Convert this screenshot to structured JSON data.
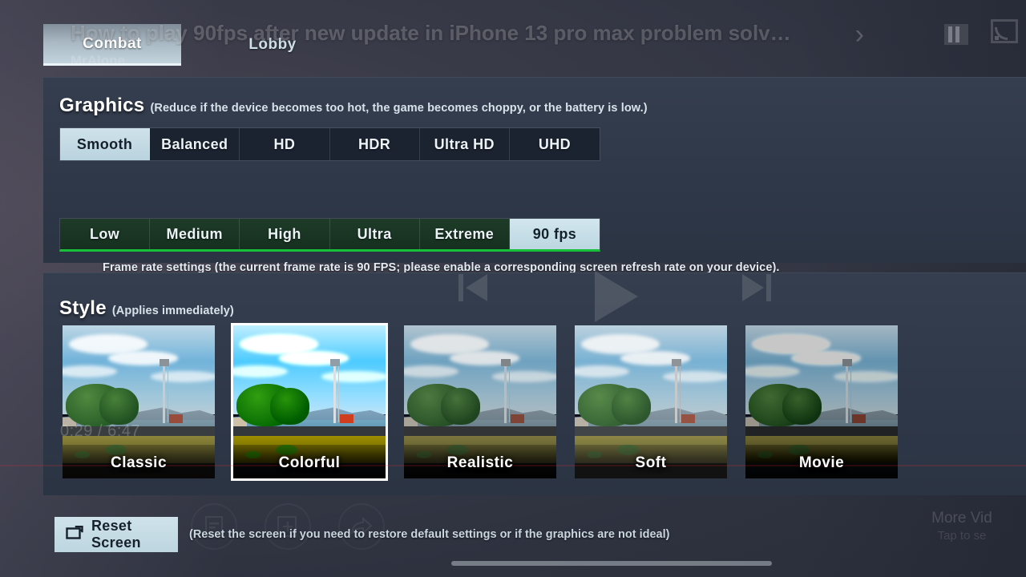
{
  "player": {
    "video_title": "How to play 90fps after new update in iPhone 13 pro max problem solv…",
    "channel": "MrAlone",
    "current_time": "0:29",
    "duration": "6:47",
    "time_display": "0:29 / 6:47",
    "chevron_icon": "chevron-right-icon",
    "pause_icon": "pause-icon",
    "cast_icon": "cast-icon",
    "prev_icon": "skip-previous-icon",
    "play_icon": "play-icon",
    "next_icon": "skip-next-icon",
    "more_videos_title": "More Vid",
    "more_videos_sub": "Tap to se",
    "action_icons": [
      "subtitles-icon",
      "add-to-playlist-icon",
      "share-icon"
    ]
  },
  "tabs": [
    {
      "label": "Combat",
      "selected": true
    },
    {
      "label": "Lobby",
      "selected": false
    }
  ],
  "graphics": {
    "title": "Graphics",
    "note": "(Reduce if the device becomes too hot, the game becomes choppy, or the battery is low.)",
    "options": [
      "Smooth",
      "Balanced",
      "HD",
      "HDR",
      "Ultra HD",
      "UHD"
    ],
    "selected": "Smooth",
    "selected_index": 0
  },
  "frame_rate": {
    "note": "Frame rate settings (the current frame rate is 90 FPS; please enable a corresponding screen refresh rate on your device).",
    "current_fps": "90 FPS",
    "options": [
      "Low",
      "Medium",
      "High",
      "Ultra",
      "Extreme",
      "90 fps"
    ],
    "selected": "90 fps",
    "selected_index": 5
  },
  "style": {
    "title": "Style",
    "note": "(Applies immediately)",
    "options": [
      "Classic",
      "Colorful",
      "Realistic",
      "Soft",
      "Movie"
    ],
    "selected": "Colorful",
    "selected_index": 1
  },
  "reset": {
    "button_label": "Reset Screen",
    "button_icon": "reset-screen-icon",
    "note": "(Reset the screen if you need to restore default settings or if the graphics are not ideal)"
  },
  "colors": {
    "accent_selected": "#cfe2ea",
    "fps_bar_green": "#18c03a",
    "panel_bg": "#2f3849",
    "seg_dark": "#1c2330",
    "seg_green": "#1e3b28",
    "selection_corner": "#f5c518",
    "scrub_red": "#ff2828"
  }
}
